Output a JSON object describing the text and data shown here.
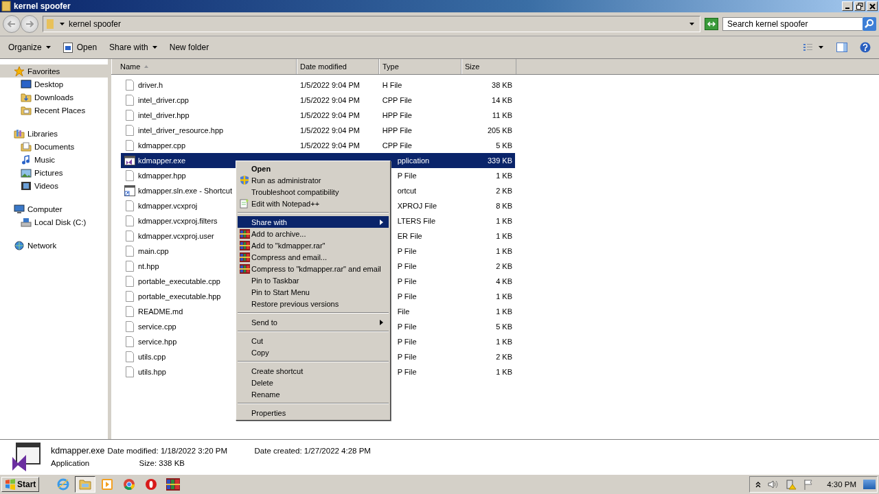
{
  "window": {
    "title": "kernel spoofer"
  },
  "address": {
    "path": "kernel spoofer"
  },
  "search": {
    "placeholder": "Search kernel spoofer"
  },
  "toolbar": [
    {
      "label": "Organize",
      "kind": "dropdown"
    },
    {
      "label": "Open",
      "kind": "open"
    },
    {
      "label": "Share with",
      "kind": "dropdown"
    },
    {
      "label": "New folder",
      "kind": "plain"
    }
  ],
  "sidebar": {
    "items": [
      {
        "label": "Favorites",
        "selected": true,
        "children": [
          {
            "label": "Desktop",
            "selected": false
          },
          {
            "label": "Downloads",
            "selected": false
          },
          {
            "label": "Recent Places",
            "selected": false
          }
        ]
      },
      {
        "label": "Libraries",
        "selected": false,
        "children": [
          {
            "label": "Documents",
            "selected": false
          },
          {
            "label": "Music",
            "selected": false
          },
          {
            "label": "Pictures",
            "selected": false
          },
          {
            "label": "Videos",
            "selected": false
          }
        ]
      },
      {
        "label": "Computer",
        "selected": false,
        "children": [
          {
            "label": "Local Disk (C:)",
            "selected": false
          }
        ]
      },
      {
        "label": "Network",
        "selected": false
      }
    ]
  },
  "table": {
    "columns": [
      "Name",
      "Date modified",
      "Type",
      "Size"
    ],
    "rows": [
      {
        "name": "driver.h",
        "date": "1/5/2022 9:04 PM",
        "type": "H File",
        "size": "38 KB",
        "kind": "doc",
        "selected": false
      },
      {
        "name": "intel_driver.cpp",
        "date": "1/5/2022 9:04 PM",
        "type": "CPP File",
        "size": "14 KB",
        "kind": "doc",
        "selected": false
      },
      {
        "name": "intel_driver.hpp",
        "date": "1/5/2022 9:04 PM",
        "type": "HPP File",
        "size": "11 KB",
        "kind": "doc",
        "selected": false
      },
      {
        "name": "intel_driver_resource.hpp",
        "date": "1/5/2022 9:04 PM",
        "type": "HPP File",
        "size": "205 KB",
        "kind": "doc",
        "selected": false
      },
      {
        "name": "kdmapper.cpp",
        "date": "1/5/2022 9:04 PM",
        "type": "CPP File",
        "size": "5 KB",
        "kind": "doc",
        "selected": false
      },
      {
        "name": "kdmapper.exe",
        "type": "pplication",
        "size": "339 KB",
        "kind": "exe",
        "selected": true
      },
      {
        "name": "kdmapper.hpp",
        "type": "P File",
        "size": "1 KB",
        "kind": "doc",
        "selected": false
      },
      {
        "name": "kdmapper.sln.exe - Shortcut",
        "type": "ortcut",
        "size": "2 KB",
        "kind": "shortcut",
        "selected": false
      },
      {
        "name": "kdmapper.vcxproj",
        "type": "XPROJ File",
        "size": "8 KB",
        "kind": "doc",
        "selected": false
      },
      {
        "name": "kdmapper.vcxproj.filters",
        "type": "LTERS File",
        "size": "1 KB",
        "kind": "doc",
        "selected": false
      },
      {
        "name": "kdmapper.vcxproj.user",
        "type": "ER File",
        "size": "1 KB",
        "kind": "doc",
        "selected": false
      },
      {
        "name": "main.cpp",
        "type": "P File",
        "size": "1 KB",
        "kind": "doc",
        "selected": false
      },
      {
        "name": "nt.hpp",
        "type": "P File",
        "size": "2 KB",
        "kind": "doc",
        "selected": false
      },
      {
        "name": "portable_executable.cpp",
        "type": "P File",
        "size": "4 KB",
        "kind": "doc",
        "selected": false
      },
      {
        "name": "portable_executable.hpp",
        "type": "P File",
        "size": "1 KB",
        "kind": "doc",
        "selected": false
      },
      {
        "name": "README.md",
        "type": "File",
        "size": "1 KB",
        "kind": "doc",
        "selected": false
      },
      {
        "name": "service.cpp",
        "type": "P File",
        "size": "5 KB",
        "kind": "doc",
        "selected": false
      },
      {
        "name": "service.hpp",
        "type": "P File",
        "size": "1 KB",
        "kind": "doc",
        "selected": false
      },
      {
        "name": "utils.cpp",
        "type": "P File",
        "size": "2 KB",
        "kind": "doc",
        "selected": false
      },
      {
        "name": "utils.hpp",
        "type": "P File",
        "size": "1 KB",
        "kind": "doc",
        "selected": false
      }
    ]
  },
  "context_menu": {
    "groups": [
      [
        {
          "label": "Open",
          "kind": "plain",
          "default": true,
          "submenu": false,
          "selected": false
        },
        {
          "label": "Run as administrator",
          "kind": "shield",
          "default": false,
          "submenu": false,
          "selected": false
        },
        {
          "label": "Troubleshoot compatibility",
          "kind": "plain",
          "default": false,
          "submenu": false,
          "selected": false
        },
        {
          "label": "Edit with Notepad++",
          "kind": "notepad",
          "default": false,
          "submenu": false,
          "selected": false
        }
      ],
      [
        {
          "label": "Share with",
          "kind": "plain",
          "default": false,
          "submenu": true,
          "selected": true
        },
        {
          "label": "Add to archive...",
          "kind": "archive",
          "default": false,
          "submenu": false,
          "selected": false
        },
        {
          "label": "Add to \"kdmapper.rar\"",
          "kind": "archive",
          "default": false,
          "submenu": false,
          "selected": false
        },
        {
          "label": "Compress and email...",
          "kind": "archive",
          "default": false,
          "submenu": false,
          "selected": false
        },
        {
          "label": "Compress to \"kdmapper.rar\" and email",
          "kind": "archive",
          "default": false,
          "submenu": false,
          "selected": false
        },
        {
          "label": "Pin to Taskbar",
          "kind": "plain",
          "default": false,
          "submenu": false,
          "selected": false
        },
        {
          "label": "Pin to Start Menu",
          "kind": "plain",
          "default": false,
          "submenu": false,
          "selected": false
        },
        {
          "label": "Restore previous versions",
          "kind": "plain",
          "default": false,
          "submenu": false,
          "selected": false
        }
      ],
      [
        {
          "label": "Send to",
          "kind": "plain",
          "default": false,
          "submenu": true,
          "selected": false
        }
      ],
      [
        {
          "label": "Cut",
          "kind": "plain",
          "default": false,
          "submenu": false,
          "selected": false
        },
        {
          "label": "Copy",
          "kind": "plain",
          "default": false,
          "submenu": false,
          "selected": false
        }
      ],
      [
        {
          "label": "Create shortcut",
          "kind": "plain",
          "default": false,
          "submenu": false,
          "selected": false
        },
        {
          "label": "Delete",
          "kind": "plain",
          "default": false,
          "submenu": false,
          "selected": false
        },
        {
          "label": "Rename",
          "kind": "plain",
          "default": false,
          "submenu": false,
          "selected": false
        }
      ],
      [
        {
          "label": "Properties",
          "kind": "plain",
          "default": false,
          "submenu": false,
          "selected": false
        }
      ]
    ]
  },
  "details": {
    "name": "kdmapper.exe",
    "type": "Application",
    "fields": [
      {
        "label": "Date modified:",
        "value": "1/18/2022 3:20 PM"
      },
      {
        "label": "Date created:",
        "value": "1/27/2022 4:28 PM"
      },
      {
        "label": "Size:",
        "value": "338 KB"
      }
    ]
  },
  "taskbar": {
    "start": "Start",
    "apps": [
      {
        "kind": "ie",
        "selected": false
      },
      {
        "kind": "explorer",
        "selected": true
      },
      {
        "kind": "media",
        "selected": false
      },
      {
        "kind": "chrome",
        "selected": false
      },
      {
        "kind": "opera",
        "selected": false
      },
      {
        "kind": "winrar",
        "selected": false
      }
    ],
    "clock": "4:30 PM"
  }
}
